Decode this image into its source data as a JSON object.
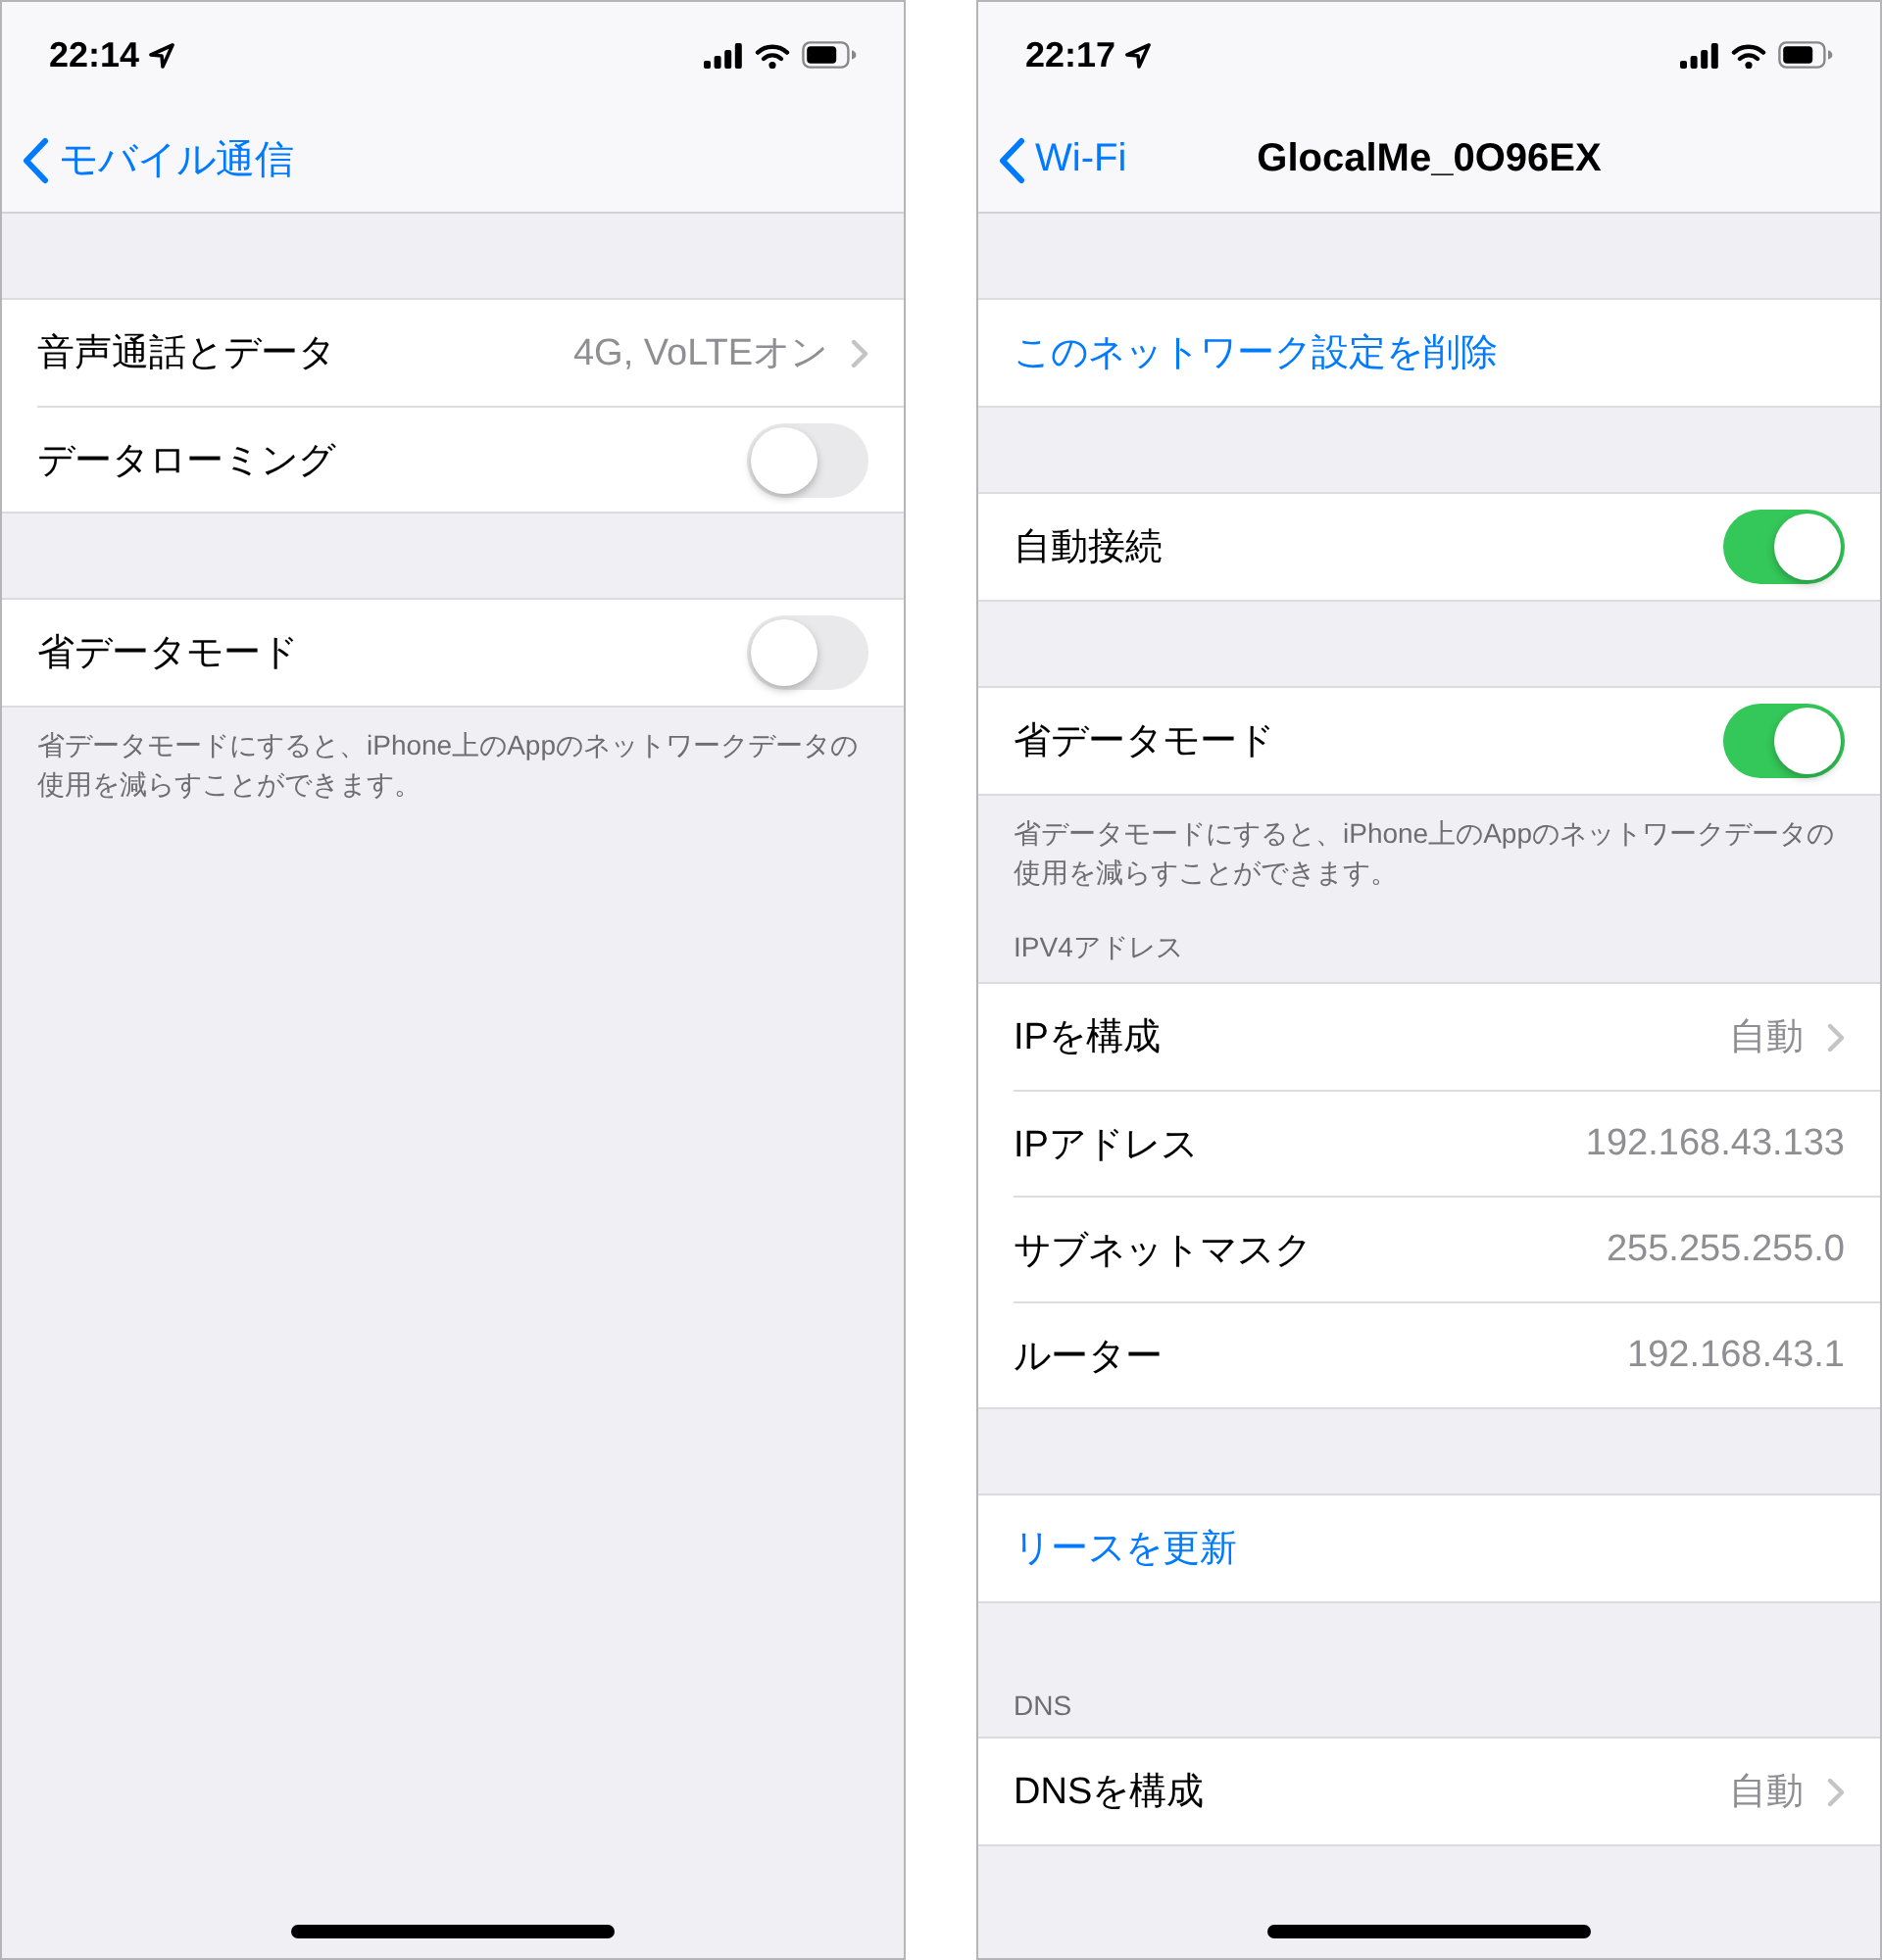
{
  "phones": [
    {
      "status_bar": {
        "time": "22:14"
      },
      "nav": {
        "back": "モバイル通信"
      },
      "sections": [
        {
          "rows": [
            {
              "kind": "detail",
              "label": "音声通話とデータ",
              "value": "4G, VoLTEオン"
            },
            {
              "kind": "toggle",
              "label": "データローミング",
              "on": false
            }
          ]
        },
        {
          "rows": [
            {
              "kind": "toggle",
              "label": "省データモード",
              "on": false
            }
          ],
          "footer": "省データモードにすると、iPhone上のAppのネットワークデータの使用を減らすことができます。"
        }
      ]
    },
    {
      "status_bar": {
        "time": "22:17"
      },
      "nav": {
        "back": "Wi-Fi",
        "title": "GlocalMe_0O96EX"
      },
      "sections": [
        {
          "rows": [
            {
              "kind": "action",
              "label": "このネットワーク設定を削除"
            }
          ]
        },
        {
          "rows": [
            {
              "kind": "toggle",
              "label": "自動接続",
              "on": true
            }
          ]
        },
        {
          "rows": [
            {
              "kind": "toggle",
              "label": "省データモード",
              "on": true
            }
          ],
          "footer": "省データモードにすると、iPhone上のAppのネットワークデータの使用を減らすことができます。"
        },
        {
          "header": "IPV4アドレス",
          "rows": [
            {
              "kind": "detail",
              "label": "IPを構成",
              "value": "自動"
            },
            {
              "kind": "value",
              "label": "IPアドレス",
              "value": "192.168.43.133"
            },
            {
              "kind": "value",
              "label": "サブネットマスク",
              "value": "255.255.255.0"
            },
            {
              "kind": "value",
              "label": "ルーター",
              "value": "192.168.43.1"
            }
          ]
        },
        {
          "rows": [
            {
              "kind": "action",
              "label": "リースを更新"
            }
          ]
        },
        {
          "header": "DNS",
          "rows": [
            {
              "kind": "detail",
              "label": "DNSを構成",
              "value": "自動"
            }
          ]
        }
      ]
    }
  ]
}
